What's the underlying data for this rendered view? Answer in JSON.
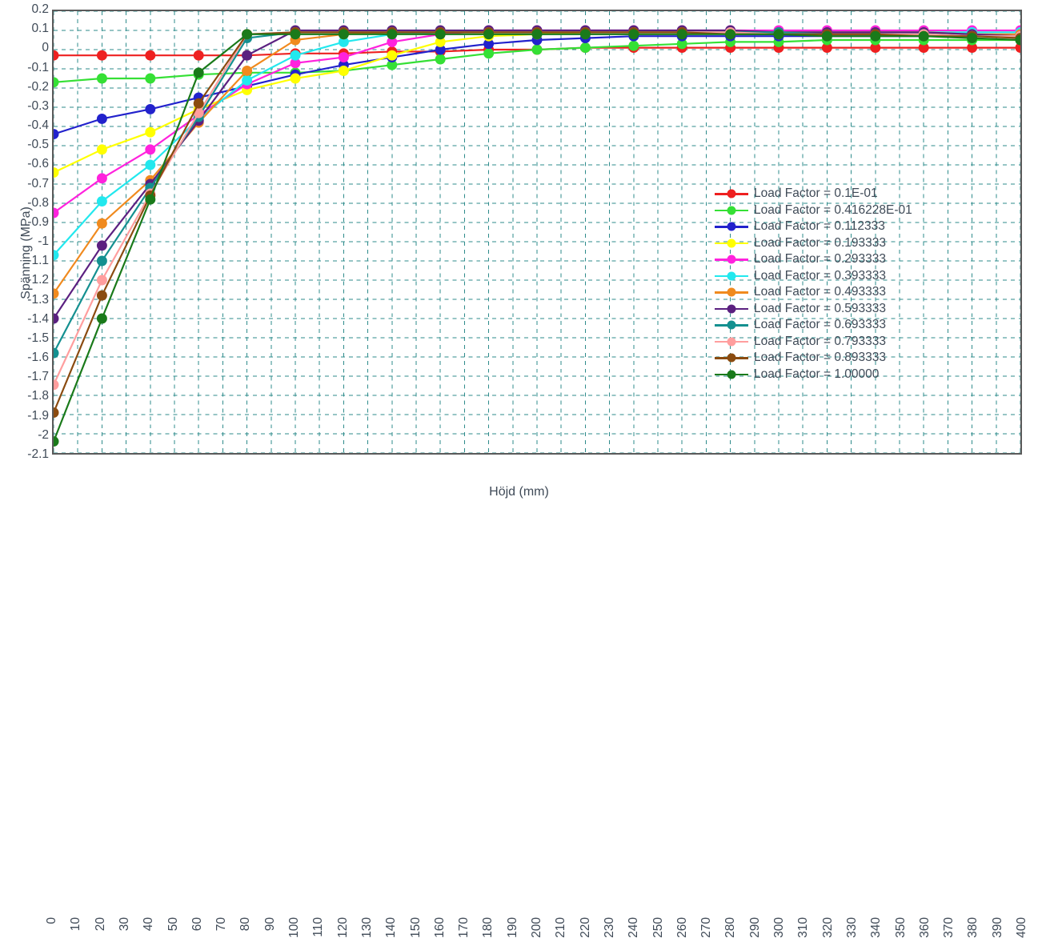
{
  "chart_data": {
    "type": "line",
    "title": "",
    "xlabel": "Höjd (mm)",
    "ylabel": "Spänning (MPa)",
    "xlim": [
      0,
      400
    ],
    "ylim": [
      -2.1,
      0.2
    ],
    "xticks": [
      0,
      10,
      20,
      30,
      40,
      50,
      60,
      70,
      80,
      90,
      100,
      110,
      120,
      130,
      140,
      150,
      160,
      170,
      180,
      190,
      200,
      210,
      220,
      230,
      240,
      250,
      260,
      270,
      280,
      290,
      300,
      310,
      320,
      330,
      340,
      350,
      360,
      370,
      380,
      390,
      400
    ],
    "yticks": [
      0.2,
      0.1,
      0,
      -0.1,
      -0.2,
      -0.3,
      -0.4,
      -0.5,
      -0.6,
      -0.7,
      -0.8,
      -0.9,
      -1,
      -1.1,
      -1.2,
      -1.3,
      -1.4,
      -1.5,
      -1.6,
      -1.7,
      -1.8,
      -1.9,
      -2,
      -2.1
    ],
    "grid": true,
    "grid_color": "#2e8b8b",
    "grid_style": "dashed",
    "legend_position": "center-right",
    "marker": "circle",
    "x": [
      0,
      20,
      40,
      60,
      80,
      100,
      120,
      140,
      160,
      180,
      200,
      220,
      240,
      260,
      280,
      300,
      320,
      340,
      360,
      380,
      400
    ],
    "series": [
      {
        "name": "Load Factor = 0.1E-01",
        "color": "#ee2020",
        "values": [
          -0.03,
          -0.03,
          -0.03,
          -0.03,
          -0.03,
          -0.02,
          -0.02,
          -0.01,
          -0.01,
          0.0,
          0.0,
          0.01,
          0.01,
          0.01,
          0.01,
          0.01,
          0.01,
          0.01,
          0.01,
          0.01,
          0.01
        ]
      },
      {
        "name": "Load Factor = 0.416228E-01",
        "color": "#35e035",
        "values": [
          -0.17,
          -0.15,
          -0.15,
          -0.13,
          -0.12,
          -0.12,
          -0.11,
          -0.08,
          -0.05,
          -0.02,
          0.0,
          0.01,
          0.02,
          0.03,
          0.04,
          0.04,
          0.05,
          0.05,
          0.05,
          0.05,
          0.05
        ]
      },
      {
        "name": "Load Factor = 0.112333",
        "color": "#2222cc",
        "values": [
          -0.44,
          -0.36,
          -0.31,
          -0.25,
          -0.19,
          -0.13,
          -0.08,
          -0.04,
          0.0,
          0.03,
          0.05,
          0.06,
          0.07,
          0.07,
          0.07,
          0.07,
          0.07,
          0.07,
          0.07,
          0.07,
          0.07
        ]
      },
      {
        "name": "Load Factor = 0.193333",
        "color": "#ffff00",
        "values": [
          -0.64,
          -0.52,
          -0.43,
          -0.31,
          -0.21,
          -0.15,
          -0.11,
          -0.03,
          0.04,
          0.07,
          0.08,
          0.09,
          0.09,
          0.09,
          0.09,
          0.09,
          0.09,
          0.09,
          0.09,
          0.09,
          0.09
        ]
      },
      {
        "name": "Load Factor = 0.293333",
        "color": "#ff22dd",
        "values": [
          -0.85,
          -0.67,
          -0.52,
          -0.34,
          -0.18,
          -0.07,
          -0.04,
          0.04,
          0.08,
          0.1,
          0.1,
          0.1,
          0.1,
          0.1,
          0.1,
          0.1,
          0.1,
          0.1,
          0.1,
          0.1,
          0.1
        ]
      },
      {
        "name": "Load Factor = 0.393333",
        "color": "#22e8ee",
        "values": [
          -1.07,
          -0.79,
          -0.6,
          -0.36,
          -0.16,
          -0.03,
          0.04,
          0.08,
          0.09,
          0.09,
          0.09,
          0.09,
          0.09,
          0.09,
          0.09,
          0.09,
          0.09,
          0.09,
          0.09,
          0.09,
          0.09
        ]
      },
      {
        "name": "Load Factor = 0.493333",
        "color": "#f08a1e",
        "values": [
          -1.27,
          -0.905,
          -0.68,
          -0.38,
          -0.11,
          0.05,
          0.08,
          0.09,
          0.09,
          0.09,
          0.09,
          0.09,
          0.09,
          0.09,
          0.09,
          0.09,
          0.09,
          0.09,
          0.09,
          0.08,
          0.08
        ]
      },
      {
        "name": "Load Factor = 0.593333",
        "color": "#5b2080",
        "values": [
          -1.4,
          -1.02,
          -0.7,
          -0.37,
          -0.03,
          0.1,
          0.1,
          0.1,
          0.1,
          0.1,
          0.1,
          0.1,
          0.1,
          0.1,
          0.1,
          0.09,
          0.09,
          0.09,
          0.09,
          0.08,
          0.07
        ]
      },
      {
        "name": "Load Factor = 0.693333",
        "color": "#149090",
        "values": [
          -1.58,
          -1.1,
          -0.72,
          -0.35,
          0.06,
          0.09,
          0.09,
          0.09,
          0.09,
          0.09,
          0.09,
          0.09,
          0.09,
          0.09,
          0.09,
          0.09,
          0.08,
          0.08,
          0.08,
          0.07,
          0.07
        ]
      },
      {
        "name": "Load Factor = 0.793333",
        "color": "#ff9e9e",
        "values": [
          -1.745,
          -1.2,
          -0.75,
          -0.33,
          0.08,
          0.09,
          0.09,
          0.09,
          0.09,
          0.09,
          0.09,
          0.09,
          0.09,
          0.09,
          0.09,
          0.08,
          0.08,
          0.08,
          0.08,
          0.07,
          0.07
        ]
      },
      {
        "name": "Load Factor = 0.893333",
        "color": "#8a4b10",
        "values": [
          -1.89,
          -1.28,
          -0.76,
          -0.28,
          0.08,
          0.09,
          0.09,
          0.09,
          0.09,
          0.09,
          0.09,
          0.09,
          0.09,
          0.09,
          0.08,
          0.08,
          0.08,
          0.08,
          0.07,
          0.07,
          0.06
        ]
      },
      {
        "name": "Load Factor = 1.00000",
        "color": "#1a7a1a",
        "values": [
          -2.04,
          -1.4,
          -0.78,
          -0.12,
          0.08,
          0.08,
          0.08,
          0.08,
          0.08,
          0.08,
          0.08,
          0.08,
          0.08,
          0.08,
          0.08,
          0.08,
          0.07,
          0.07,
          0.07,
          0.06,
          0.05
        ]
      }
    ]
  }
}
